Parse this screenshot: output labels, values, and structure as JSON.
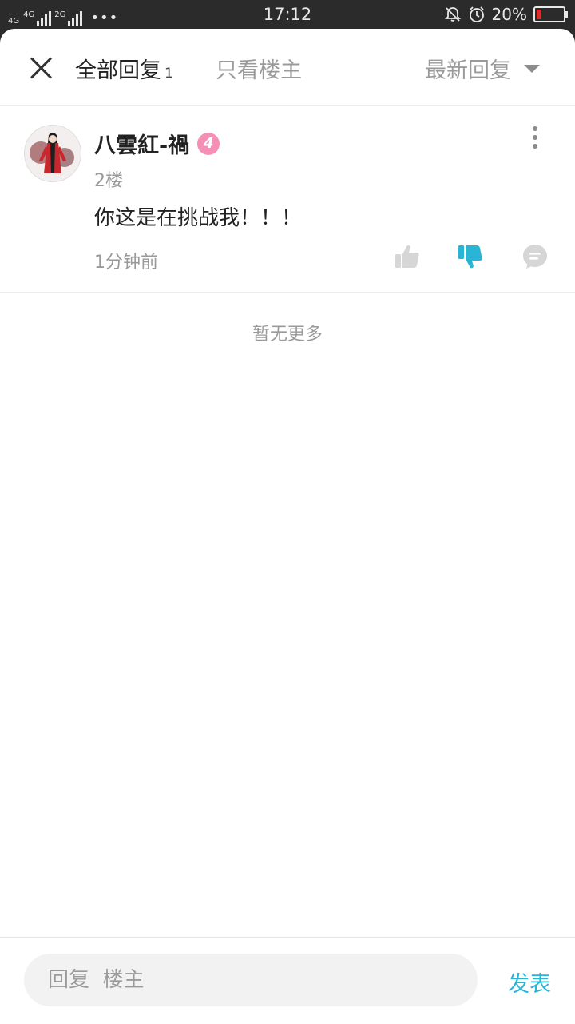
{
  "status": {
    "net1": "4G",
    "net2": "4G",
    "net3": "2G",
    "dots": "•••",
    "time": "17:12",
    "battery_text": "20%",
    "battery_level": 0.2,
    "battery_color": "#e12a2a"
  },
  "header": {
    "tab_all": "全部回复",
    "tab_all_count": "1",
    "tab_owner": "只看楼主",
    "sort_label": "最新回复"
  },
  "comment": {
    "username": "八雲紅-禍",
    "level": "4",
    "floor": "2楼",
    "text": "你这是在挑战我！！！",
    "time": "1分钟前"
  },
  "footer_note": "暂无更多",
  "composer": {
    "placeholder": "回复  楼主",
    "value": "",
    "send_label": "发表"
  },
  "colors": {
    "accent": "#29b6d6",
    "level_badge": "#f58fb5",
    "icon_gray": "#d6d6d6"
  },
  "icons": [
    "close-icon",
    "chevron-down-icon",
    "more-icon",
    "thumbs-up-icon",
    "thumbs-down-icon",
    "comment-icon",
    "mute-icon",
    "alarm-icon"
  ]
}
